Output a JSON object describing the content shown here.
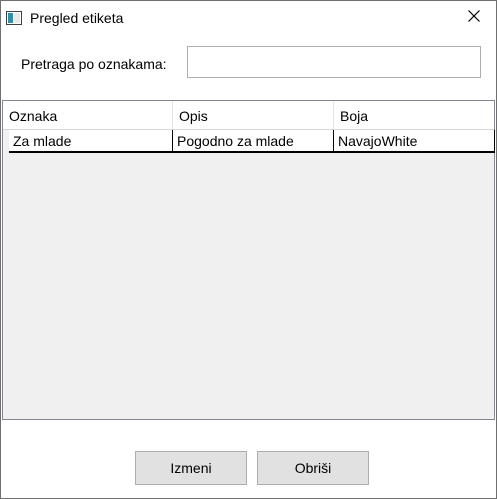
{
  "window": {
    "title": "Pregled etiketa"
  },
  "search": {
    "label": "Pretraga po oznakama:",
    "value": "",
    "placeholder": ""
  },
  "table": {
    "columns": [
      "Oznaka",
      "Opis",
      "Boja"
    ],
    "rows": [
      [
        "Za mlade",
        "Pogodno za mlade",
        "NavajoWhite"
      ]
    ]
  },
  "buttons": {
    "edit_label": "Izmeni",
    "delete_label": "Obriši"
  },
  "colors": {
    "grid_background": "#f0f0f0",
    "button_background": "#e1e1e1",
    "input_border": "#abadb3"
  }
}
